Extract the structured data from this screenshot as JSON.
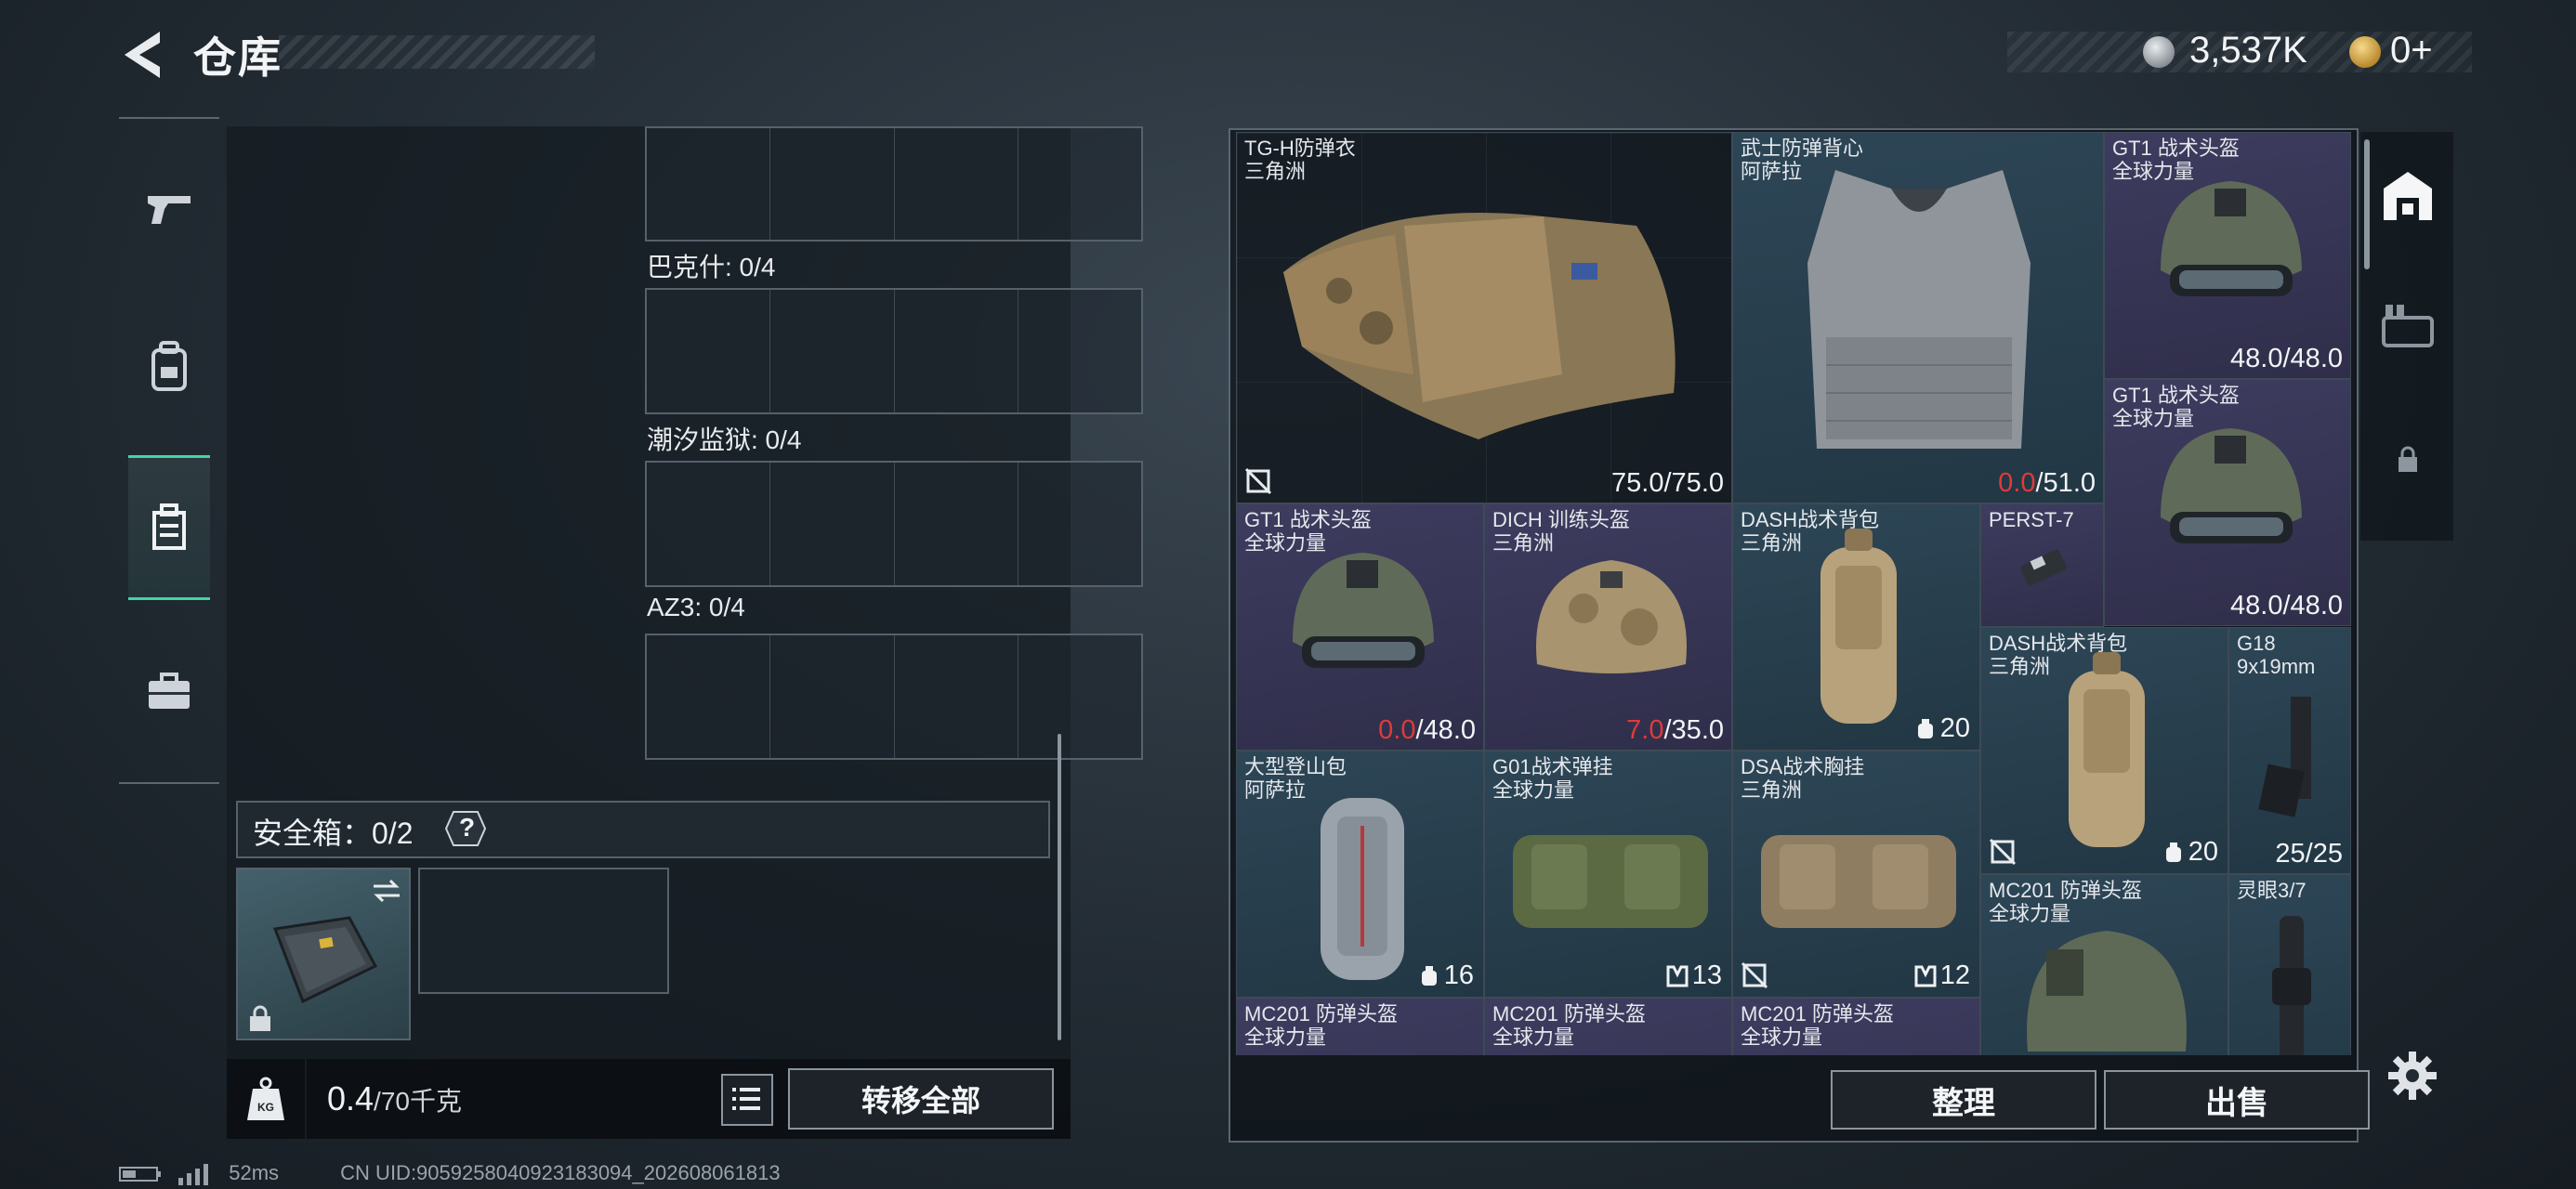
{
  "header": {
    "title": "仓库"
  },
  "currency": {
    "silver": "3,537K",
    "gold": "0+"
  },
  "stash": {
    "containers": [
      {
        "label": "巴克什: 0/4"
      },
      {
        "label": "潮汐监狱: 0/4"
      },
      {
        "label": "AZ3: 0/4"
      }
    ],
    "safe_box_label": "安全箱：0/2",
    "help": "?"
  },
  "bottom_left": {
    "weight": "0.4",
    "weight_unit": "/70千克",
    "kg_icon": "KG",
    "transfer_all": "转移全部"
  },
  "warehouse": {
    "items": [
      {
        "name1": "TG-H防弹衣",
        "name2": "三角洲",
        "dur_cur": "75.0",
        "dur_max": "/75.0",
        "low": false
      },
      {
        "name1": "武士防弹背心",
        "name2": "阿萨拉",
        "dur_cur": "0.0",
        "dur_max": "/51.0",
        "low": true
      },
      {
        "name1": "GT1 战术头盔",
        "name2": "全球力量",
        "dur_cur": "48.0",
        "dur_max": "/48.0",
        "low": false
      },
      {
        "name1": "GT1 战术头盔",
        "name2": "全球力量",
        "dur_cur": "48.0",
        "dur_max": "/48.0",
        "low": false
      },
      {
        "name1": "GT1 战术头盔",
        "name2": "全球力量",
        "dur_cur": "0.0",
        "dur_max": "/48.0",
        "low": true
      },
      {
        "name1": "DICH 训练头盔",
        "name2": "三角洲",
        "dur_cur": "7.0",
        "dur_max": "/35.0",
        "low": true
      },
      {
        "name1": "DASH战术背包",
        "name2": "三角洲",
        "cap": "20"
      },
      {
        "name1": "PERST-7",
        "name2": ""
      },
      {
        "name1": "DASH战术背包",
        "name2": "三角洲",
        "cap": "20"
      },
      {
        "name1": "G18",
        "name2": "9x19mm",
        "ammo": "25/25"
      },
      {
        "name1": "大型登山包",
        "name2": "阿萨拉",
        "cap": "16"
      },
      {
        "name1": "G01战术弹挂",
        "name2": "全球力量",
        "cap": "13"
      },
      {
        "name1": "DSA战术胸挂",
        "name2": "三角洲",
        "cap": "12"
      },
      {
        "name1": "MC201 防弹头盔",
        "name2": "全球力量"
      },
      {
        "name1": "灵眼3/7",
        "name2": ""
      },
      {
        "name1": "MC201 防弹头盔",
        "name2": "全球力量"
      },
      {
        "name1": "MC201 防弹头盔",
        "name2": "全球力量"
      },
      {
        "name1": "MC201 防弹头盔",
        "name2": "全球力量"
      }
    ]
  },
  "buttons": {
    "sort": "整理",
    "sell": "出售"
  },
  "status": {
    "ping": "52ms",
    "uid": "CN UID:9059258040923183094_202608061813"
  }
}
